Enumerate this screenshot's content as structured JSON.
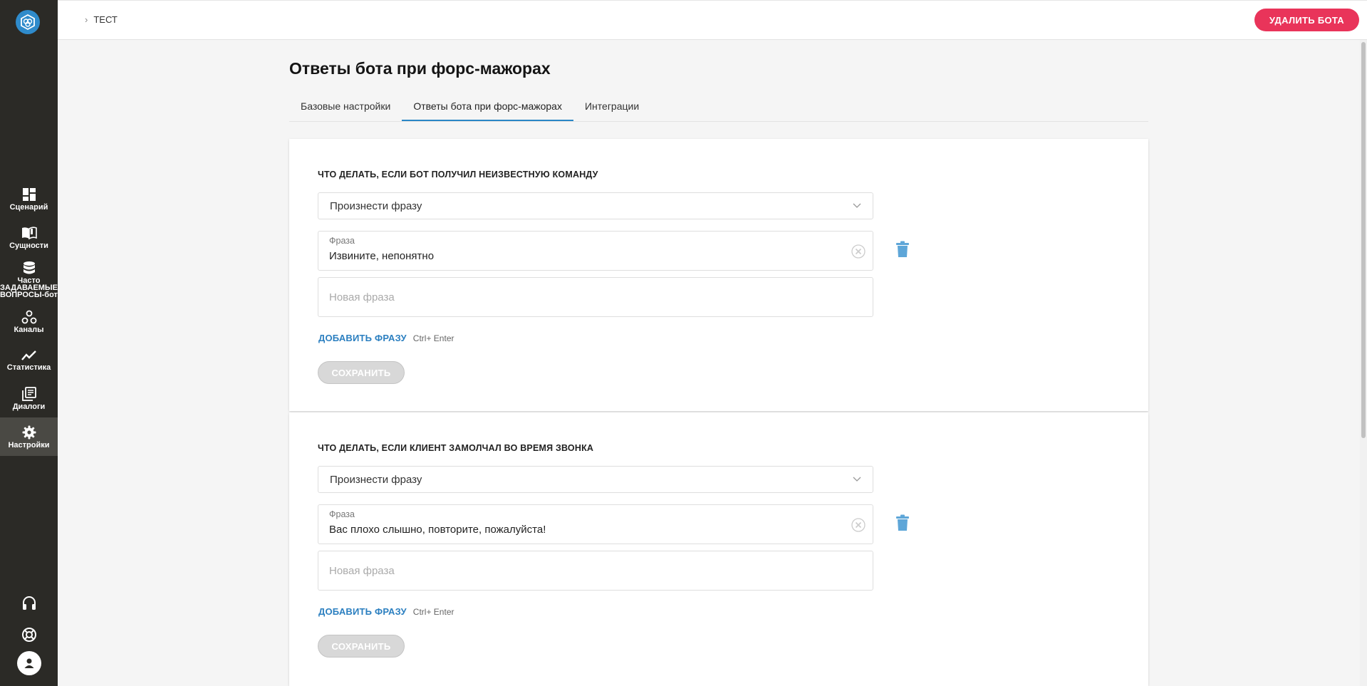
{
  "sidebar": {
    "items": [
      {
        "label": "Сценарий",
        "icon": "dashboard-icon"
      },
      {
        "label": "Сущности",
        "icon": "book-icon"
      },
      {
        "label": "Часто ЗАДАВАЕМЫЕ ВОПРОСЫ-бот",
        "icon": "database-icon"
      },
      {
        "label": "Каналы",
        "icon": "channels-icon"
      },
      {
        "label": "Статистика",
        "icon": "chart-icon"
      },
      {
        "label": "Диалоги",
        "icon": "dialogs-icon"
      },
      {
        "label": "Настройки",
        "icon": "gear-icon",
        "active": true
      }
    ],
    "bottom": [
      "headset-icon",
      "lifebuoy-icon",
      "avatar-icon"
    ]
  },
  "header": {
    "breadcrumb": "ТЕСТ",
    "delete_label": "УДАЛИТЬ БОТА"
  },
  "page": {
    "title": "Ответы бота при форс-мажорах",
    "tabs": [
      {
        "label": "Базовые настройки"
      },
      {
        "label": "Ответы бота при форс-мажорах",
        "active": true
      },
      {
        "label": "Интеграции"
      }
    ]
  },
  "sections": [
    {
      "title": "ЧТО ДЕЛАТЬ, ЕСЛИ БОТ ПОЛУЧИЛ НЕИЗВЕСТНУЮ КОМАНДУ",
      "action": "Произнести фразу",
      "phrase_label": "Фраза",
      "phrase_value": "Извините, непонятно",
      "new_phrase_placeholder": "Новая фраза",
      "add_label": "ДОБАВИТЬ ФРАЗУ",
      "hint": "Ctrl+ Enter",
      "save_label": "СОХРАНИТЬ"
    },
    {
      "title": "ЧТО ДЕЛАТЬ, ЕСЛИ КЛИЕНТ ЗАМОЛЧАЛ ВО ВРЕМЯ ЗВОНКА",
      "action": "Произнести фразу",
      "phrase_label": "Фраза",
      "phrase_value": "Вас плохо слышно, повторите, пожалуйста!",
      "new_phrase_placeholder": "Новая фраза",
      "add_label": "ДОБАВИТЬ ФРАЗУ",
      "hint": "Ctrl+ Enter",
      "save_label": "СОХРАНИТЬ"
    }
  ],
  "colors": {
    "sidebar_bg": "#2b2a26",
    "accent": "#2b7fc0",
    "danger": "#e9345a",
    "trash": "#5ea6d8"
  }
}
